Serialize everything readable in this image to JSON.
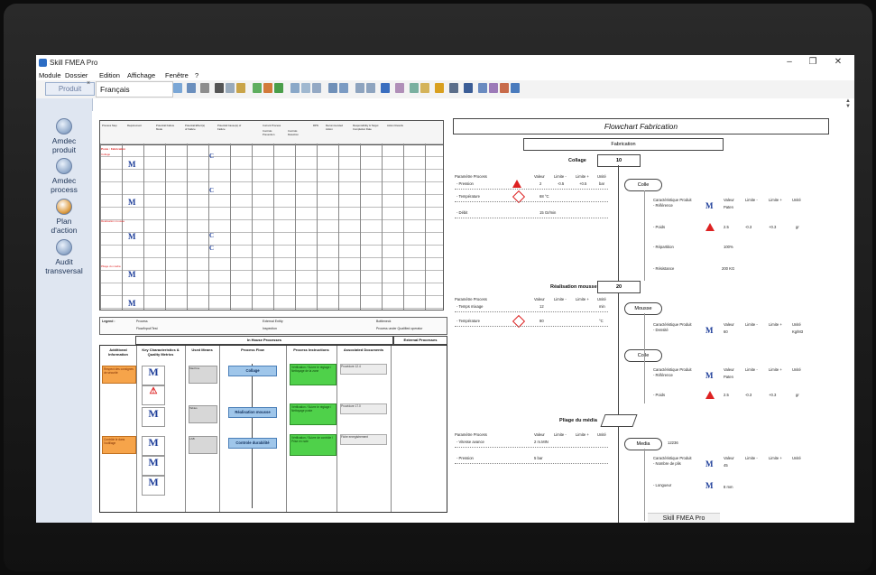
{
  "window": {
    "title": "Skill FMEA Pro",
    "status_text": "Skill FMEA Pro"
  },
  "menu": [
    "Module",
    "Dossier",
    "Edition",
    "Affichage",
    "Fenêtre",
    "?"
  ],
  "toolbar": {
    "language": "Français",
    "product_tab": "Produit"
  },
  "sidebar": [
    {
      "label1": "Amdec",
      "label2": "produit"
    },
    {
      "label1": "Amdec",
      "label2": "process"
    },
    {
      "label1": "Plan",
      "label2": "d'action"
    },
    {
      "label1": "Audit",
      "label2": "transversal"
    }
  ],
  "fmea": {
    "headers": [
      "Process Step",
      "Requirement",
      "Potential Failure Mode",
      "Potential Effect(s) of Failure",
      "Potential Cause(s) of Failure",
      "Current Process",
      "Controls Prevention",
      "Controls Detection",
      "RPN",
      "Recommended Action",
      "Responsibility & Target Completion Date",
      "Action Results"
    ],
    "section": "Poste : Fabrication",
    "rows": [
      "Collage",
      "Réalisation mousse",
      "Pliage du média"
    ]
  },
  "legend": {
    "title": "Legend :",
    "items": [
      "Process",
      "Flow/Input/Test",
      "External Entity",
      "Inspection",
      "Bottleneck",
      "Process under Qualified operator"
    ]
  },
  "process_flow": {
    "in_house": "In House Processes",
    "external": "External Processes",
    "columns": [
      "Additional Information",
      "Key Characteristics & Quality Metrics",
      "Used Means",
      "Process Flow",
      "Process Instructions",
      "Associated Documents"
    ],
    "steps": [
      {
        "name": "Collage",
        "info": "Respect des consignes de sécurité",
        "means": "Machine",
        "doc": "Procédure 12.4",
        "instr": "Vérification / Suivre le réglage / Nettoyage de la zone"
      },
      {
        "name": "Réalisation mousse",
        "info": "",
        "means": "Tables",
        "doc": "Procédure 17.0",
        "instr": "Vérification / Suivre le réglage / Nettoyage poste"
      },
      {
        "name": "Controle durabilité",
        "info": "Contrôle le dans l'outillage",
        "means": "LAB",
        "doc": "Fiche enregistrement",
        "instr": "Vérification / Suivre de contrôle / Prise en note"
      }
    ]
  },
  "flowchart": {
    "title": "Flowchart Fabrication",
    "top": "Fabrication",
    "param_header": [
      "Paramètre Process",
      "Valeur",
      "Limite -",
      "Limite +",
      "Unité"
    ],
    "char_header": [
      "Caractéristique Produit",
      "Valeur",
      "Limite -",
      "Limite +",
      "Unité"
    ],
    "steps": [
      {
        "name": "Collage",
        "num": "10",
        "pill": "Colle",
        "params": [
          {
            "name": "- Pression",
            "value": "2",
            "min": "-0.5",
            "max": "+0.5",
            "unit": "bar"
          },
          {
            "name": "- Température",
            "value": "68 °C",
            "min": "",
            "max": "",
            "unit": ""
          },
          {
            "name": "- Débit",
            "value": "15 Gr/min",
            "min": "",
            "max": "",
            "unit": ""
          }
        ],
        "chars": [
          {
            "name": "- Référence",
            "value": "Paten",
            "min": "",
            "max": "",
            "unit": ""
          },
          {
            "name": "- Poids",
            "value": "2.5",
            "min": "-0.3",
            "max": "+0.3",
            "unit": "gr"
          },
          {
            "name": "- Répartition",
            "value": "100%",
            "min": "",
            "max": "",
            "unit": ""
          },
          {
            "name": "- Résistance",
            "value": "200 KG",
            "min": "",
            "max": "",
            "unit": ""
          }
        ]
      },
      {
        "name": "Réalisation mousse",
        "num": "20",
        "pill": "Mousse",
        "pill2": "Colle",
        "params": [
          {
            "name": "- Temps mixage",
            "value": "12",
            "min": "",
            "max": "",
            "unit": "min"
          },
          {
            "name": "- Température",
            "value": "80",
            "min": "",
            "max": "",
            "unit": "°C"
          }
        ],
        "chars": [
          {
            "name": "- Densité",
            "value": "60",
            "min": "",
            "max": "",
            "unit": "Kg/M3"
          },
          {
            "name": "- Référence",
            "value": "Paten",
            "min": "",
            "max": "",
            "unit": ""
          },
          {
            "name": "- Poids",
            "value": "2.5",
            "min": "-0.3",
            "max": "+0.3",
            "unit": "gr"
          }
        ]
      },
      {
        "name": "Pliage du média",
        "num": "",
        "pill": "Media",
        "pill_value": "12236",
        "params": [
          {
            "name": "- Vitesse avance",
            "value": "2 m.MIN",
            "min": "",
            "max": "",
            "unit": ""
          },
          {
            "name": "- Pression",
            "value": "5 bar",
            "min": "",
            "max": "",
            "unit": ""
          }
        ],
        "chars": [
          {
            "name": "- Nombre de plis",
            "value": "45",
            "min": "",
            "max": "",
            "unit": ""
          },
          {
            "name": "- Longueur",
            "value": "8 mm",
            "min": "",
            "max": "",
            "unit": ""
          }
        ]
      }
    ]
  }
}
